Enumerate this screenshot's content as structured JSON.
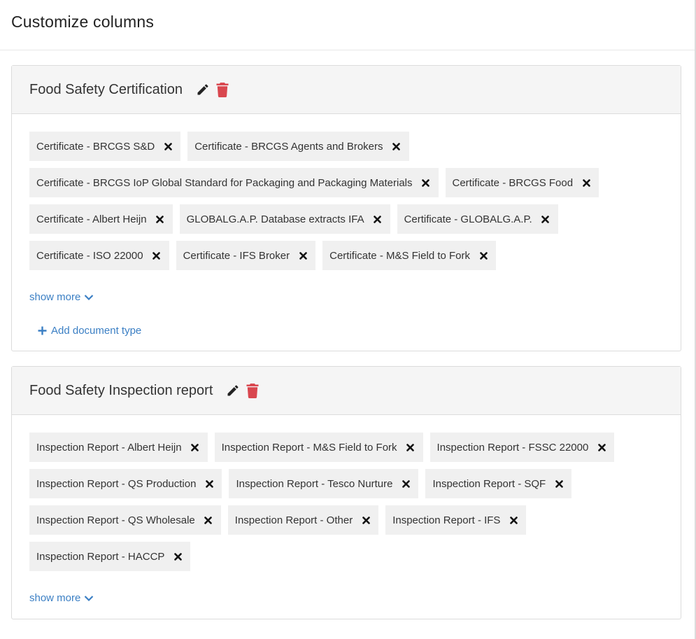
{
  "page": {
    "title": "Customize columns"
  },
  "colors": {
    "link": "#3b7fc4",
    "delete": "#d9474f",
    "chip_bg": "#f0f0f0"
  },
  "icons": {
    "edit": "pencil-icon",
    "delete": "trash-icon",
    "remove": "close-icon",
    "expand": "chevron-down-icon",
    "add": "plus-icon"
  },
  "groups": [
    {
      "title": "Food Safety Certification",
      "chips": [
        "Certificate - BRCGS S&D",
        "Certificate - BRCGS Agents and Brokers",
        "Certificate - BRCGS IoP Global Standard for Packaging and Packaging Materials",
        "Certificate - BRCGS Food",
        "Certificate - Albert Heijn",
        "GLOBALG.A.P. Database extracts IFA",
        "Certificate - GLOBALG.A.P.",
        "Certificate - ISO 22000",
        "Certificate - IFS Broker",
        "Certificate - M&S Field to Fork"
      ],
      "show_more": "show more",
      "add_label": "Add document type"
    },
    {
      "title": "Food Safety Inspection report",
      "chips": [
        "Inspection Report - Albert Heijn",
        "Inspection Report - M&S Field to Fork",
        "Inspection Report - FSSC 22000",
        "Inspection Report - QS Production",
        "Inspection Report - Tesco Nurture",
        "Inspection Report - SQF",
        "Inspection Report - QS Wholesale",
        "Inspection Report - Other",
        "Inspection Report - IFS",
        "Inspection Report - HACCP"
      ],
      "show_more": "show more"
    }
  ]
}
